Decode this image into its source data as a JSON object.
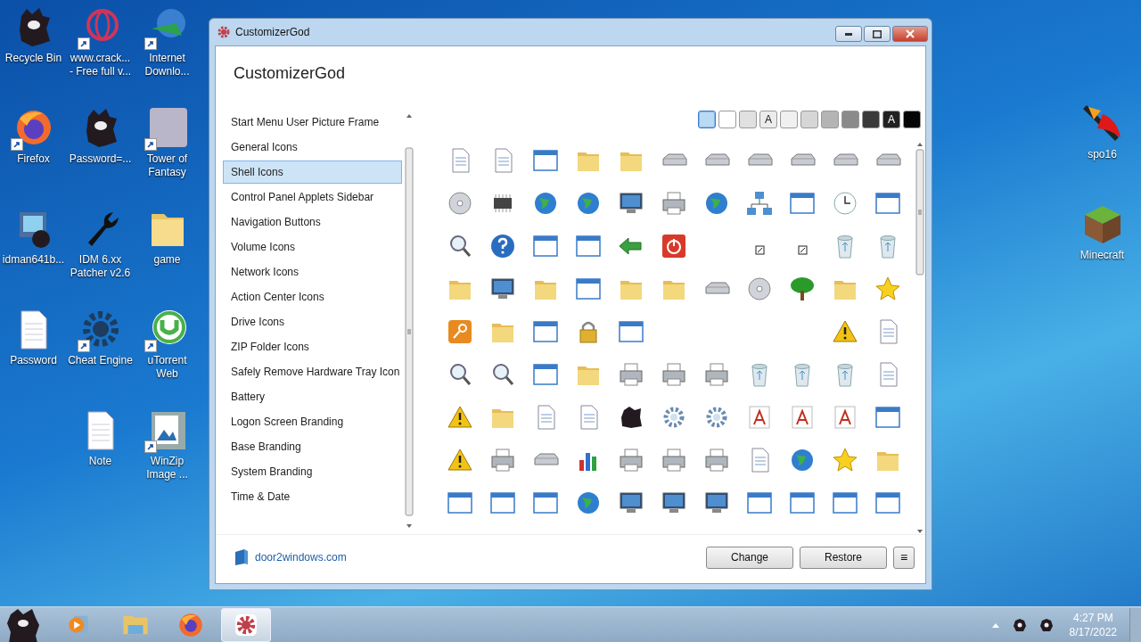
{
  "desktop": {
    "rows": [
      [
        {
          "kind": "blob",
          "label_lines": [
            "Recycle Bin"
          ],
          "shortcut": false
        },
        {
          "kind": "ring",
          "label_lines": [
            "www.crack...",
            "- Free full v..."
          ],
          "shortcut": true
        },
        {
          "kind": "globe",
          "label_lines": [
            "Internet",
            "Downlo..."
          ],
          "shortcut": true
        }
      ],
      [
        {
          "kind": "fox",
          "label_lines": [
            "Firefox"
          ],
          "shortcut": true
        },
        {
          "kind": "blob",
          "label_lines": [
            "Password=..."
          ],
          "shortcut": false
        },
        {
          "kind": "picture",
          "label_lines": [
            "Tower of",
            "Fantasy"
          ],
          "shortcut": true
        }
      ],
      [
        {
          "kind": "installer",
          "label_lines": [
            "idman641b..."
          ],
          "shortcut": false
        },
        {
          "kind": "wrench",
          "label_lines": [
            "IDM 6.xx",
            "Patcher v2.6"
          ],
          "shortcut": false
        },
        {
          "kind": "folder",
          "label_lines": [
            "game"
          ],
          "shortcut": false
        }
      ],
      [
        {
          "kind": "document",
          "label_lines": [
            "Password"
          ],
          "shortcut": false
        },
        {
          "kind": "gear",
          "label_lines": [
            "Cheat Engine"
          ],
          "shortcut": true
        },
        {
          "kind": "torrent",
          "label_lines": [
            "uTorrent",
            "Web"
          ],
          "shortcut": true
        }
      ],
      [
        null,
        {
          "kind": "document",
          "label_lines": [
            "Note"
          ],
          "shortcut": false
        },
        {
          "kind": "image",
          "label_lines": [
            "WinZip",
            "Image ..."
          ],
          "shortcut": true
        }
      ]
    ],
    "right_icons": [
      {
        "kind": "sword",
        "label_lines": [
          "spo16"
        ],
        "shortcut": false
      },
      {
        "kind": "block",
        "label_lines": [
          "Minecraft"
        ],
        "shortcut": false
      }
    ]
  },
  "window": {
    "title": "CustomizerGod",
    "heading": "CustomizerGod",
    "sidebar": {
      "items": [
        {
          "label": "Start Menu User Picture Frame",
          "selected": false
        },
        {
          "label": "General Icons",
          "selected": false
        },
        {
          "label": "Shell Icons",
          "selected": true
        },
        {
          "label": "Control Panel Applets Sidebar",
          "selected": false
        },
        {
          "label": "Navigation Buttons",
          "selected": false
        },
        {
          "label": "Volume Icons",
          "selected": false
        },
        {
          "label": "Network Icons",
          "selected": false
        },
        {
          "label": "Action Center Icons",
          "selected": false
        },
        {
          "label": "Drive Icons",
          "selected": false
        },
        {
          "label": "ZIP Folder Icons",
          "selected": false
        },
        {
          "label": "Safely Remove Hardware Tray Icon",
          "selected": false
        },
        {
          "label": "Battery",
          "selected": false
        },
        {
          "label": "Logon Screen Branding",
          "selected": false
        },
        {
          "label": "Base Branding",
          "selected": false
        },
        {
          "label": "System Branding",
          "selected": false
        },
        {
          "label": "Time & Date",
          "selected": false
        }
      ]
    },
    "swatches": [
      {
        "color": "#b8daf2",
        "selected": true
      },
      {
        "color": "#ffffff",
        "selected": false
      },
      {
        "color": "#e0e0e0",
        "selected": false
      },
      {
        "color": "#ececec",
        "selected": false,
        "label": "A"
      },
      {
        "color": "#f0f0f0",
        "selected": false
      },
      {
        "color": "#d6d6d6",
        "selected": false
      },
      {
        "color": "#b4b4b4",
        "selected": false
      },
      {
        "color": "#8a8a8a",
        "selected": false
      },
      {
        "color": "#3a3a3a",
        "selected": false
      },
      {
        "color": "#222222",
        "selected": false,
        "label": "A"
      },
      {
        "color": "#050505",
        "selected": false
      }
    ],
    "footer": {
      "link": "door2windows.com",
      "buttons": [
        "Change",
        "Restore"
      ],
      "menu": "≡"
    }
  },
  "taskbar": {
    "apps": [
      {
        "kind": "media",
        "active": false
      },
      {
        "kind": "explorer",
        "active": false
      },
      {
        "kind": "firefox",
        "active": false
      },
      {
        "kind": "gear",
        "active": true
      }
    ],
    "time": "4:27 PM",
    "date": "8/17/2022"
  }
}
